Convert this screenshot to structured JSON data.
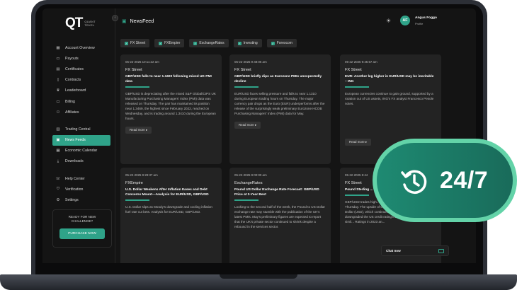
{
  "logo": {
    "mark": "QT",
    "sub1": "QUANT",
    "sub2": "TEKEL"
  },
  "sidebar": {
    "items": [
      {
        "label": "Account Overview",
        "icon": "grid-icon"
      },
      {
        "label": "Payouts",
        "icon": "wallet-icon"
      },
      {
        "label": "Certificates",
        "icon": "certificate-icon"
      },
      {
        "label": "Contracts",
        "icon": "contract-icon"
      },
      {
        "label": "Leaderboard",
        "icon": "trophy-icon"
      },
      {
        "label": "Billing",
        "icon": "billing-icon"
      },
      {
        "label": "Affiliates",
        "icon": "affiliates-icon"
      },
      {
        "label": "Trading Central",
        "icon": "chart-icon"
      },
      {
        "label": "News Feeds",
        "icon": "news-icon"
      },
      {
        "label": "Economic Calendar",
        "icon": "calendar-icon"
      },
      {
        "label": "Downloads",
        "icon": "download-icon"
      },
      {
        "label": "Help Center",
        "icon": "help-icon"
      },
      {
        "label": "Verification",
        "icon": "shield-icon"
      },
      {
        "label": "Settings",
        "icon": "gear-icon"
      }
    ],
    "promo": {
      "line1": "READY FOR NEW",
      "line2": "CHALLENGE?",
      "button": "PURCHASE NOW"
    }
  },
  "header": {
    "title": "NewsFeed",
    "user_name": "Angus Foggo",
    "user_role": "Profile",
    "avatar_initials": "AF"
  },
  "filters": [
    "FX Street",
    "FXEmpire",
    "ExchangeRates",
    "Investing",
    "Forexcom"
  ],
  "cards": [
    {
      "date": "05-22-2025 10:11:22 am",
      "source": "FX Street",
      "title": "GBP/USD falls to near 1.3400 following mixed UK PMI data",
      "body": "GBP/USD is depreciating after the mixed S&P Global/CIPS UK Manufacturing Purchasing Managers' Index (PMI) data was released on Thursday. The pair has maintained its position near 1.3469, the highest since February 2022, reached on Wednesday, and is trading around 1.3410 during the European hours.",
      "button": "Read more"
    },
    {
      "date": "05-22-2025 9:48:06 am",
      "source": "FX Street",
      "title": "GBP/USD briefly dips as Eurozone PMIs unexpectedly decline",
      "body": "EUR/USD faces selling pressure and falls to near 1.1310 during European trading hours on Thursday. The major currency pair drops as the Euro (EUR) underperforms after the release of the surprisingly weak preliminary Eurozone HCOB Purchasing Managers' Index (PMI) data for May.",
      "button": "Read more"
    },
    {
      "date": "05-22-2025 9:45:57 am",
      "source": "FX Street",
      "title": "EUR: Another leg higher in EUR/USD may be inevitable – ING",
      "body": "European currencies continue to gain ground, supported by a rotation out of US assets, ING's FX analyst Francesco Pesole notes.",
      "button": "Read more"
    },
    {
      "date": "05-22-2025 9:29:37 am",
      "source": "FXEmpire",
      "title": "U.S. Dollar Weakens After Inflation Eases and Debt Concerns Mount—Analysis for EUR/USD, GBP/USD",
      "body": "U.S. Dollar slips as Moody's downgrade and cooling inflation fuel rate cut bets. Analysis for EUR/USD, GBP/USD.",
      "button": ""
    },
    {
      "date": "05-22-2025 9:00:00 am",
      "source": "ExchangeRates",
      "title": "Pound US Dollar Exchange Rate Forecast: GBP/USD Price at 3-Year Best",
      "body": "Looking to the second half of the week, the Pound to US Dollar exchange rate may stumble with the publication of the UK's latest PMIs. May's preliminary figures are expected to report that the UK's private sector continued to shrink despite a rebound in the services sector.",
      "button": ""
    },
    {
      "date": "05-22-2025 5:44",
      "source": "FX Street",
      "title": "Pound Sterling ... USD stren... to weaken",
      "body": "GBP/USD trades high... day with trading around ... hours on Thursday. The upside of the pair is attributed to the weaker US Dollar (USD), which continues to face challenges after Moody's downgraded the US credit rating from Aaa to Aa1, following simil... Ratings in 2023 an...",
      "button": ""
    }
  ],
  "badge": {
    "text": "24/7"
  },
  "chat": {
    "label": "Chat now"
  },
  "colors": {
    "accent": "#2fa389",
    "background": "#141414",
    "card": "#232323",
    "badge_outer": "#63d3a8"
  }
}
